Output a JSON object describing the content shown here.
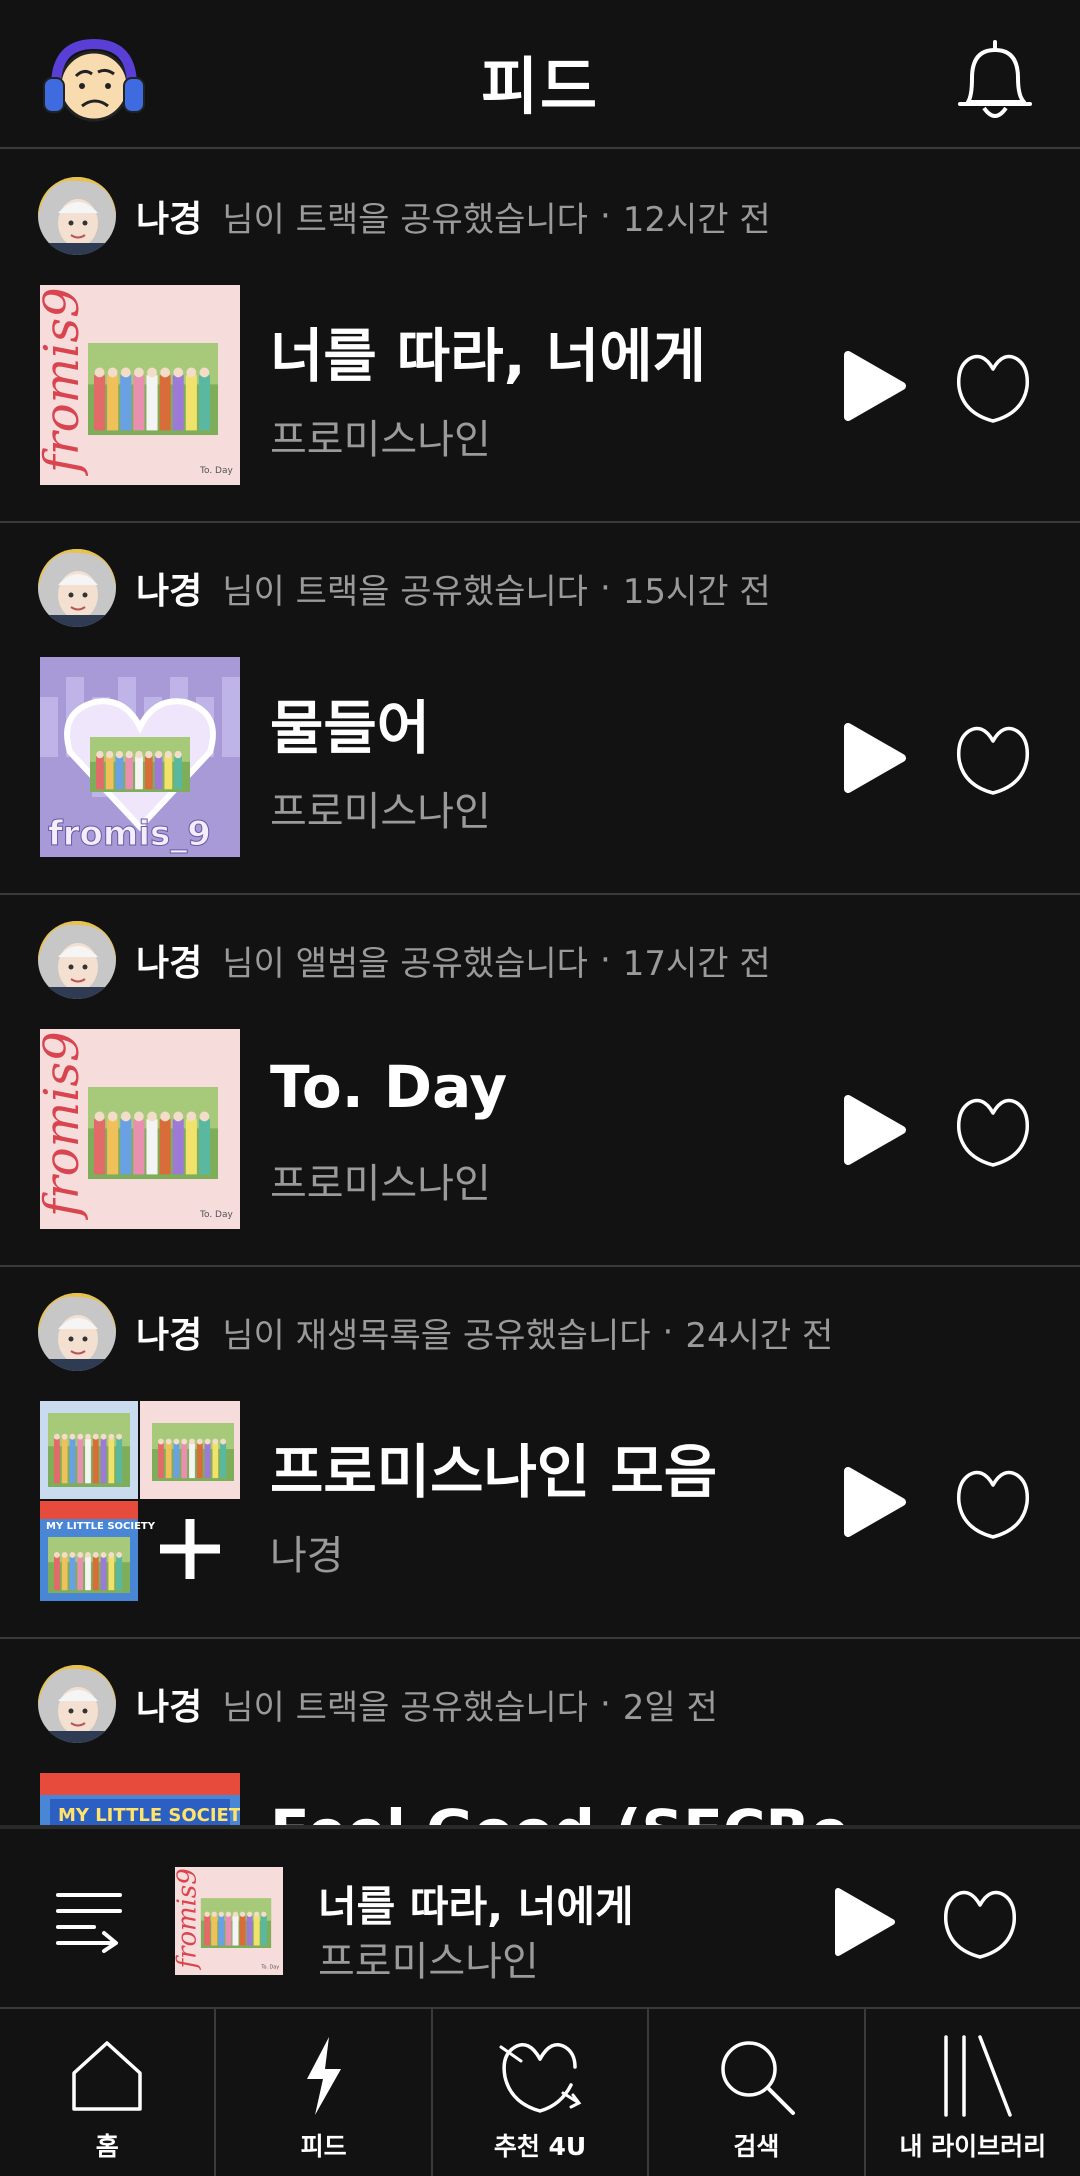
{
  "header": {
    "title": "피드",
    "profile_icon": "profile-avatar-icon",
    "notification_icon": "bell-icon"
  },
  "feed": [
    {
      "user": "나경",
      "action": "님이 트랙을 공유했습니다",
      "time": "12시간 전",
      "title": "너를 따라, 너에게",
      "artist": "프로미스나인",
      "cover_style": "pink",
      "cover_text": "fromis9"
    },
    {
      "user": "나경",
      "action": "님이 트랙을 공유했습니다",
      "time": "15시간 전",
      "title": "물들어",
      "artist": "프로미스나인",
      "cover_style": "purple",
      "cover_text": "fromis_9"
    },
    {
      "user": "나경",
      "action": "님이 앨범을 공유했습니다",
      "time": "17시간 전",
      "title": "To. Day",
      "artist": "프로미스나인",
      "cover_style": "pink",
      "cover_text": "fromis9"
    },
    {
      "user": "나경",
      "action": "님이 재생목록을 공유했습니다",
      "time": "24시간 전",
      "title": "프로미스나인 모음",
      "artist": "나경",
      "cover_style": "collage",
      "cover_text": "MY LITTLE SOCIETY"
    },
    {
      "user": "나경",
      "action": "님이 트랙을 공유했습니다",
      "time": "2일 전",
      "title": "Feel Good (SECRe...",
      "artist": "",
      "cover_style": "blue",
      "cover_text": "MY LITTLE SOCIETY"
    }
  ],
  "mini_player": {
    "title": "너를 따라, 너에게",
    "artist": "프로미스나인",
    "cover_text": "fromis9"
  },
  "nav": [
    {
      "label": "홈",
      "icon": "home-icon"
    },
    {
      "label": "피드",
      "icon": "lightning-icon"
    },
    {
      "label": "추천 4U",
      "icon": "recommend-heart-icon"
    },
    {
      "label": "검색",
      "icon": "search-icon"
    },
    {
      "label": "내 라이브러리",
      "icon": "library-icon"
    }
  ],
  "colors": {
    "background": "#121212",
    "divider": "#3a3a3a",
    "secondary_text": "#9a9a9a",
    "primary_text": "#ffffff",
    "cover_pink": "#f7dcdc",
    "cover_purple": "#a89ad6",
    "cover_blue": "#4a86d6",
    "logo_red": "#d8454f"
  }
}
